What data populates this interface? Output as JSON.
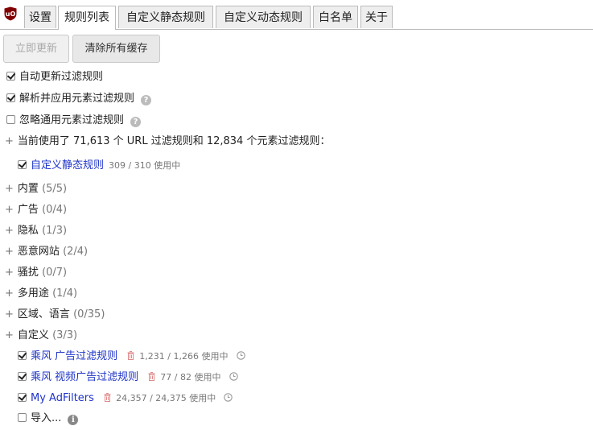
{
  "tabs": [
    "设置",
    "规则列表",
    "自定义静态规则",
    "自定义动态规则",
    "白名单",
    "关于"
  ],
  "buttons": {
    "update_now": "立即更新",
    "purge_cache": "清除所有缓存"
  },
  "options": [
    {
      "label": "自动更新过滤规则",
      "checked": true
    },
    {
      "label": "解析并应用元素过滤规则",
      "checked": true
    },
    {
      "label": "忽略通用元素过滤规则",
      "checked": false
    }
  ],
  "summary": "当前使用了 71,613 个 URL 过滤规则和 12,834 个元素过滤规则：",
  "user_filters": {
    "label": "自定义静态规则",
    "stat": "309 / 310 使用中",
    "checked": true
  },
  "groups": [
    {
      "name": "内置",
      "count": "(5/5)"
    },
    {
      "name": "广告",
      "count": "(0/4)"
    },
    {
      "name": "隐私",
      "count": "(1/3)"
    },
    {
      "name": "恶意网站",
      "count": "(2/4)"
    },
    {
      "name": "骚扰",
      "count": "(0/7)"
    },
    {
      "name": "多用途",
      "count": "(1/4)"
    },
    {
      "name": "区域、语言",
      "count": "(0/35)"
    },
    {
      "name": "自定义",
      "count": "(3/3)"
    }
  ],
  "custom_lists": [
    {
      "name": "乘风 广告过滤规则",
      "stat": "1,231 / 1,266 使用中",
      "checked": true
    },
    {
      "name": "乘风 视频广告过滤规则",
      "stat": "77 / 82 使用中",
      "checked": true
    },
    {
      "name": "My AdFilters",
      "stat": "24,357 / 24,375 使用中",
      "checked": true
    }
  ],
  "import_label": "导入...",
  "plus_sign": "+",
  "help_glyph": "?",
  "info_glyph": "i",
  "colors": {
    "link": "#1f34c8",
    "logo": "#800000"
  }
}
